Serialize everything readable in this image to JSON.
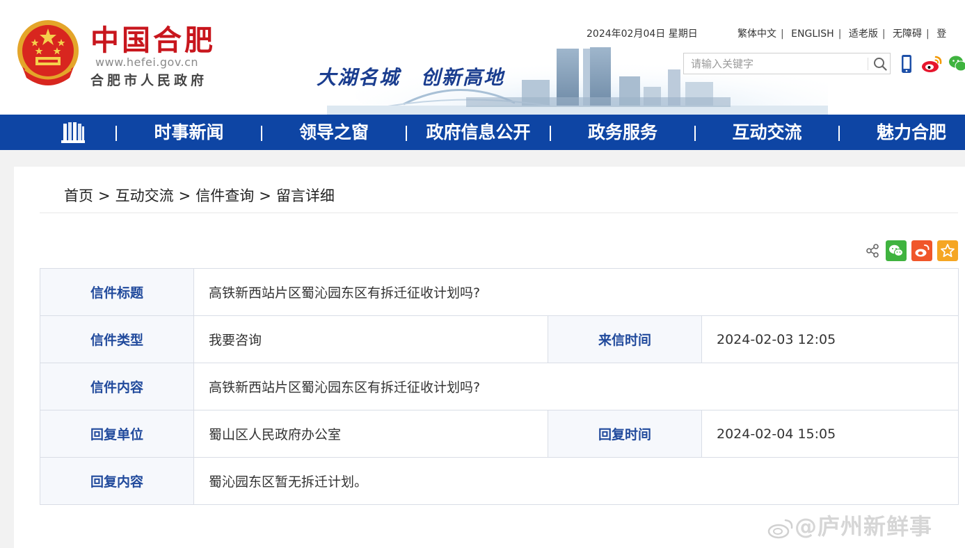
{
  "header": {
    "logo_title": "中国合肥",
    "logo_url": "www.hefei.gov.cn",
    "logo_subtitle": "合肥市人民政府",
    "slogan": "大湖名城　创新高地",
    "date": "2024年02月04日 星期日",
    "top_links": [
      "繁体中文",
      "ENGLISH",
      "适老版",
      "无障碍",
      "登"
    ],
    "search_placeholder": "请输入关键字"
  },
  "nav": {
    "items": [
      "时事新闻",
      "领导之窗",
      "政府信息公开",
      "政务服务",
      "互动交流",
      "魅力合肥"
    ]
  },
  "breadcrumb": [
    "首页",
    "互动交流",
    "信件查询",
    "留言详细"
  ],
  "breadcrumb_sep": ">",
  "letter": {
    "title_label": "信件标题",
    "title": "高铁新西站片区蜀沁园东区有拆迁征收计划吗?",
    "type_label": "信件类型",
    "type": "我要咨询",
    "received_label": "来信时间",
    "received": "2024-02-03 12:05",
    "content_label": "信件内容",
    "content": "高铁新西站片区蜀沁园东区有拆迁征收计划吗?",
    "reply_unit_label": "回复单位",
    "reply_unit": "蜀山区人民政府办公室",
    "reply_time_label": "回复时间",
    "reply_time": "2024-02-04 15:05",
    "reply_content_label": "回复内容",
    "reply_content": "蜀沁园东区暂无拆迁计划。"
  },
  "watermark": "@庐州新鲜事",
  "colors": {
    "nav_bg": "#0e45a4",
    "label_text": "#214a9c",
    "logo_red": "#c8161d",
    "wechat": "#3fb33f",
    "weibo": "#f0562a",
    "favorite": "#f5a623"
  },
  "icons": [
    "national-emblem-icon",
    "search-icon",
    "mobile-icon",
    "weibo-icon",
    "wechat-icon",
    "home-icon",
    "share-icon",
    "wechat-share-icon",
    "weibo-share-icon",
    "favorite-icon"
  ]
}
